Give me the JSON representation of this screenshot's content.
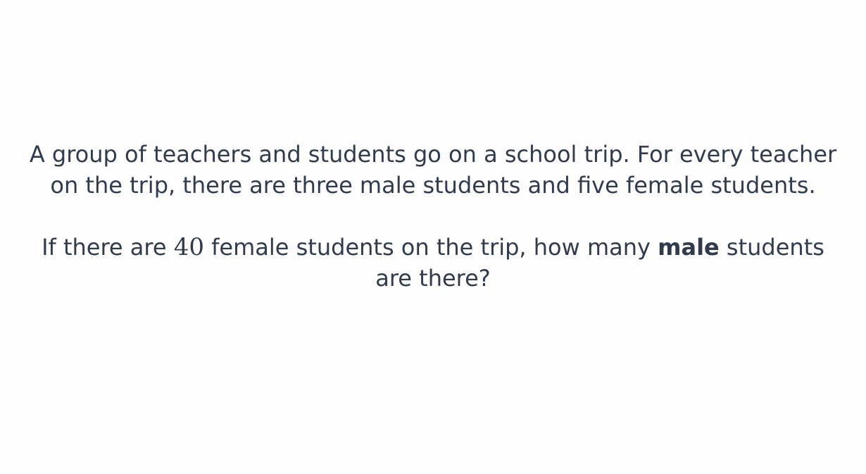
{
  "question": {
    "paragraph_1": "A group of teachers and students go on a school trip. For every teacher on the trip, there are three male students and five female students.",
    "paragraph_2": {
      "part_1": "If there are ",
      "number": "40",
      "part_2": " female students on the trip, how many ",
      "bold": "male",
      "part_3": " students are there?"
    }
  },
  "colors": {
    "background": "#fefefe",
    "text": "#313b4e"
  }
}
